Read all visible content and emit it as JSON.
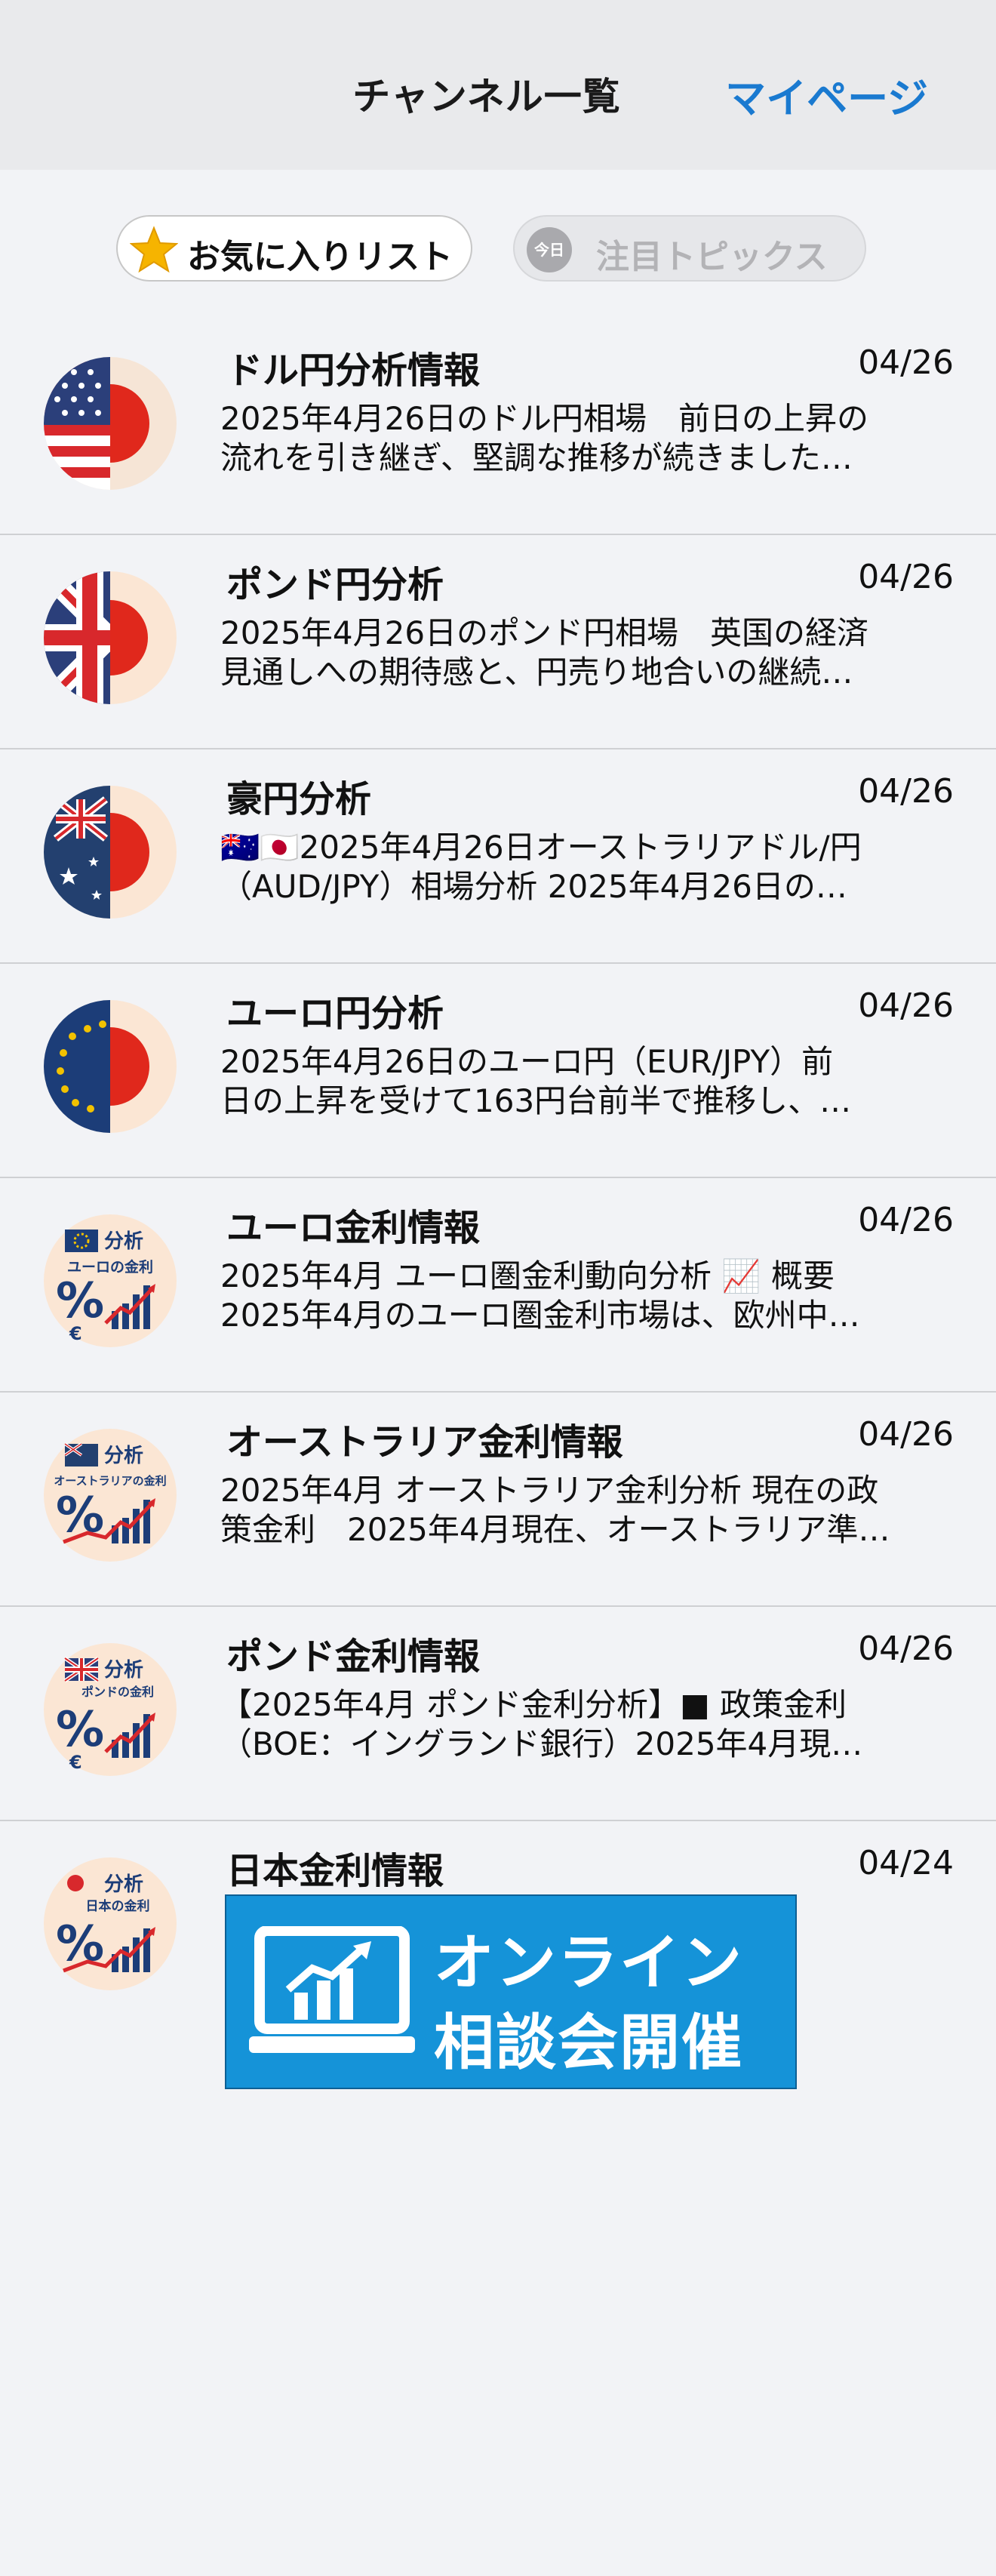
{
  "header": {
    "title": "チャンネル一覧",
    "mypage_link": "マイページ"
  },
  "tabs": {
    "favorites": {
      "label": "お気に入りリスト",
      "icon": "star-icon"
    },
    "topics": {
      "label": "注目トピックス",
      "badge": "今日"
    }
  },
  "channels": [
    {
      "title": "ドル円分析情報",
      "date": "04/26",
      "lines": [
        "2025年4月26日のドル円相場　前日の上昇の",
        "流れを引き継ぎ、堅調な推移が続きました…"
      ],
      "icon": "usd-jpy-flag-icon"
    },
    {
      "title": "ポンド円分析",
      "date": "04/26",
      "lines": [
        "2025年4月26日のポンド円相場　英国の経済",
        "見通しへの期待感と、円売り地合いの継続…"
      ],
      "icon": "gbp-jpy-flag-icon"
    },
    {
      "title": "豪円分析",
      "date": "04/26",
      "lines": [
        "🇦🇺🇯🇵2025年4月26日オーストラリアドル/円",
        "（AUD/JPY）相場分析  2025年4月26日の…"
      ],
      "icon": "aud-jpy-flag-icon"
    },
    {
      "title": "ユーロ円分析",
      "date": "04/26",
      "lines": [
        "2025年4月26日のユーロ円（EUR/JPY）前",
        "日の上昇を受けて163円台前半で推移し、…"
      ],
      "icon": "eur-jpy-flag-icon"
    },
    {
      "title": "ユーロ金利情報",
      "date": "04/26",
      "lines": [
        "2025年4月  ユーロ圏金利動向分析  📈  概要",
        "2025年4月のユーロ圏金利市場は、欧州中…"
      ],
      "icon": "euro-interest-rate-icon",
      "icon_text": {
        "top": "分析",
        "sub": "ユーロの金利"
      }
    },
    {
      "title": "オーストラリア金利情報",
      "date": "04/26",
      "lines": [
        "2025年4月  オーストラリア金利分析  現在の政",
        "策金利　2025年4月現在、オーストラリア準…"
      ],
      "icon": "australia-interest-rate-icon",
      "icon_text": {
        "top": "分析",
        "sub": "オーストラリアの金利"
      }
    },
    {
      "title": "ポンド金利情報",
      "date": "04/26",
      "lines": [
        "【2025年4月  ポンド金利分析】■  政策金利",
        "（BOE：イングランド銀行）2025年4月現…"
      ],
      "icon": "pound-interest-rate-icon",
      "icon_text": {
        "top": "分析",
        "sub": "ポンドの金利"
      }
    },
    {
      "title": "日本金利情報",
      "date": "04/24",
      "lines": [],
      "icon": "japan-interest-rate-icon",
      "icon_text": {
        "top": "分析",
        "sub": "日本の金利"
      }
    }
  ],
  "banner": {
    "line1": "オンライン",
    "line2": "相談会開催",
    "icon": "monitor-chart-icon"
  },
  "colors": {
    "accent": "#1a7ad0",
    "banner": "#1593d8",
    "background": "#f2f3f6"
  }
}
